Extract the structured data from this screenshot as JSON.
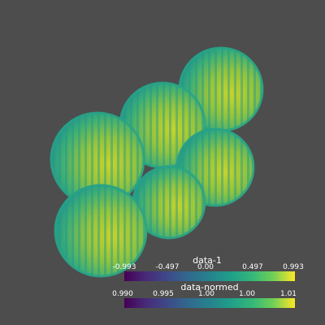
{
  "colormap_name": "viridis",
  "background_color": "#4d4d4d",
  "scene": {
    "object_count": 6,
    "description_hidden": "six shaded spheres with striped surface scalars"
  },
  "scalar_bars": [
    {
      "title": "data-1",
      "ticks": [
        "-0.993",
        "-0.497",
        "0.00",
        "0.497",
        "0.993"
      ]
    },
    {
      "title": "data-normed",
      "ticks": [
        "0.990",
        "0.995",
        "1.00",
        "1.00",
        "1.01"
      ]
    }
  ]
}
